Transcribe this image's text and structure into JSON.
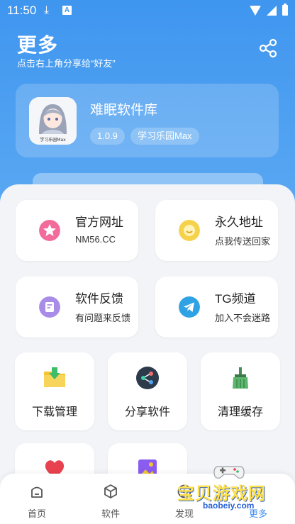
{
  "status_bar": {
    "time": "11:50"
  },
  "header": {
    "title": "更多",
    "subtitle": "点击右上角分享给“好友”"
  },
  "app": {
    "name": "难眠软件库",
    "version": "1.0.9",
    "tag": "学习乐园Max",
    "logo_caption": "学习乐园Max"
  },
  "links": [
    {
      "title": "官方网址",
      "subtitle": "NM56.CC",
      "icon": "star-icon",
      "color": "#f26b9a"
    },
    {
      "title": "永久地址",
      "subtitle": "点我传送回家",
      "icon": "smile-icon",
      "color": "#f6d14a"
    },
    {
      "title": "软件反馈",
      "subtitle": "有问题来反馈",
      "icon": "feedback-icon",
      "color": "#a98be8"
    },
    {
      "title": "TG频道",
      "subtitle": "加入不会迷路",
      "icon": "telegram-icon",
      "color": "#2ea2e4"
    }
  ],
  "tools": [
    {
      "label": "下载管理",
      "icon": "download-folder-icon"
    },
    {
      "label": "分享软件",
      "icon": "share-icon"
    },
    {
      "label": "清理缓存",
      "icon": "broom-icon"
    }
  ],
  "more_tools": [
    {
      "icon": "heart-icon"
    },
    {
      "icon": "gallery-icon"
    }
  ],
  "nav": [
    {
      "label": "首页",
      "icon": "home-icon"
    },
    {
      "label": "软件",
      "icon": "cube-icon"
    },
    {
      "label": "发现",
      "icon": "discover-icon"
    },
    {
      "label": "更多",
      "icon": "more-icon"
    }
  ],
  "watermark": {
    "text": "宝贝游戏网",
    "url": "baobeiy.com"
  },
  "colors": {
    "primary": "#4e9ef0",
    "background": "#f2f4f8",
    "active": "#3f8ef0"
  }
}
